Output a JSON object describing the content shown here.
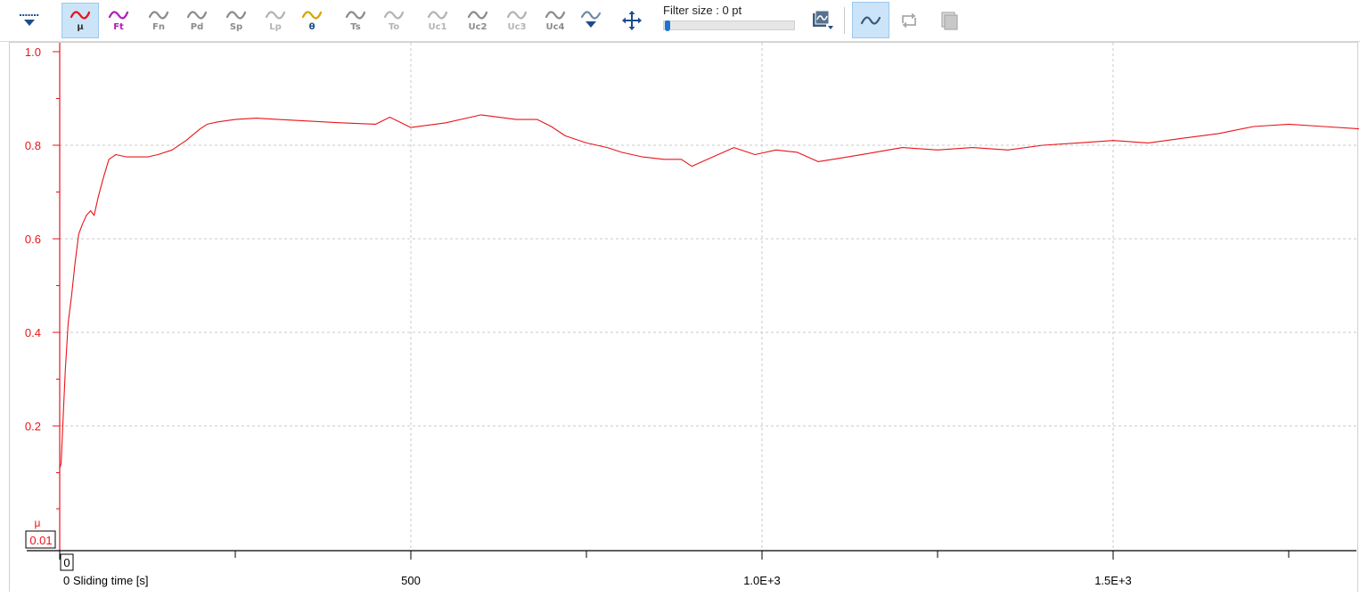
{
  "toolbar": {
    "channels": [
      {
        "label": "μ",
        "color": "#e8141b",
        "label_color": "#333333",
        "active": true
      },
      {
        "label": "Ft",
        "color": "#b020b8",
        "label_color": "#b020b8",
        "active": false
      },
      {
        "label": "Fn",
        "color": "#8c8c8c",
        "label_color": "#8c8c8c",
        "active": false
      },
      {
        "label": "Pd",
        "color": "#8c8c8c",
        "label_color": "#8c8c8c",
        "active": false
      },
      {
        "label": "Sp",
        "color": "#8c8c8c",
        "label_color": "#8c8c8c",
        "active": false
      },
      {
        "label": "Lp",
        "color": "#b4b4b4",
        "label_color": "#b4b4b4",
        "active": false
      },
      {
        "label": "θ",
        "color": "#d9a400",
        "label_color": "#1c4c8c",
        "active": false
      },
      {
        "label": "Ts",
        "color": "#8c8c8c",
        "label_color": "#8c8c8c",
        "active": false
      },
      {
        "label": "To",
        "color": "#b4b4b4",
        "label_color": "#b4b4b4",
        "active": false
      },
      {
        "label": "Uc1",
        "color": "#b4b4b4",
        "label_color": "#b4b4b4",
        "active": false
      },
      {
        "label": "Uc2",
        "color": "#8c8c8c",
        "label_color": "#8c8c8c",
        "active": false
      },
      {
        "label": "Uc3",
        "color": "#b4b4b4",
        "label_color": "#b4b4b4",
        "active": false
      },
      {
        "label": "Uc4",
        "color": "#8c8c8c",
        "label_color": "#8c8c8c",
        "active": false
      }
    ],
    "filter_label": "Filter size : 0 pt",
    "filter_value": 0,
    "icons": {
      "marker_menu": "marker-dropdown-icon",
      "more_channels": "more-channels-dropdown-icon",
      "pan": "pan-move-icon",
      "export": "chart-export-dropdown-icon",
      "curve_mode": "curve-mode-icon",
      "replay": "replay-icon",
      "layers": "layers-icon"
    }
  },
  "chart_data": {
    "type": "line",
    "series": [
      {
        "name": "μ",
        "color": "#e8141b",
        "points": [
          [
            0,
            0.11
          ],
          [
            2,
            0.12
          ],
          [
            5,
            0.22
          ],
          [
            8,
            0.32
          ],
          [
            12,
            0.42
          ],
          [
            17,
            0.48
          ],
          [
            22,
            0.55
          ],
          [
            27,
            0.61
          ],
          [
            32,
            0.63
          ],
          [
            38,
            0.65
          ],
          [
            44,
            0.66
          ],
          [
            49,
            0.65
          ],
          [
            55,
            0.69
          ],
          [
            62,
            0.73
          ],
          [
            70,
            0.77
          ],
          [
            80,
            0.78
          ],
          [
            95,
            0.775
          ],
          [
            110,
            0.775
          ],
          [
            125,
            0.775
          ],
          [
            140,
            0.78
          ],
          [
            160,
            0.79
          ],
          [
            180,
            0.81
          ],
          [
            200,
            0.835
          ],
          [
            210,
            0.845
          ],
          [
            225,
            0.85
          ],
          [
            250,
            0.855
          ],
          [
            280,
            0.858
          ],
          [
            300,
            0.856
          ],
          [
            350,
            0.852
          ],
          [
            400,
            0.848
          ],
          [
            450,
            0.845
          ],
          [
            470,
            0.86
          ],
          [
            500,
            0.838
          ],
          [
            550,
            0.848
          ],
          [
            600,
            0.865
          ],
          [
            650,
            0.855
          ],
          [
            680,
            0.855
          ],
          [
            700,
            0.84
          ],
          [
            720,
            0.82
          ],
          [
            750,
            0.805
          ],
          [
            780,
            0.795
          ],
          [
            800,
            0.785
          ],
          [
            830,
            0.775
          ],
          [
            860,
            0.77
          ],
          [
            885,
            0.77
          ],
          [
            900,
            0.755
          ],
          [
            930,
            0.775
          ],
          [
            960,
            0.795
          ],
          [
            990,
            0.78
          ],
          [
            1020,
            0.79
          ],
          [
            1050,
            0.785
          ],
          [
            1080,
            0.765
          ],
          [
            1110,
            0.772
          ],
          [
            1150,
            0.782
          ],
          [
            1200,
            0.795
          ],
          [
            1250,
            0.79
          ],
          [
            1300,
            0.795
          ],
          [
            1350,
            0.79
          ],
          [
            1400,
            0.8
          ],
          [
            1450,
            0.805
          ],
          [
            1500,
            0.81
          ],
          [
            1550,
            0.805
          ],
          [
            1600,
            0.815
          ],
          [
            1650,
            0.825
          ],
          [
            1700,
            0.84
          ],
          [
            1750,
            0.845
          ],
          [
            1800,
            0.84
          ],
          [
            1850,
            0.835
          ]
        ]
      }
    ],
    "y_axis": {
      "name": "μ",
      "ylim": [
        0,
        1.0
      ],
      "ticks": [
        0.2,
        0.4,
        0.6,
        0.8,
        1.0
      ],
      "tick_labels": [
        "0.2",
        "0.4",
        "0.6",
        "0.8",
        "1.0"
      ],
      "readout": "0.01",
      "color": "#e8141b"
    },
    "x_axis": {
      "xlim": [
        0,
        1870
      ],
      "ticks": [
        500,
        1000,
        1500
      ],
      "tick_labels": [
        "500",
        "1.0E+3",
        "1.5E+3"
      ],
      "origin_label": "0",
      "origin_box": "0",
      "label": "Sliding time [s]"
    },
    "grid": true
  }
}
